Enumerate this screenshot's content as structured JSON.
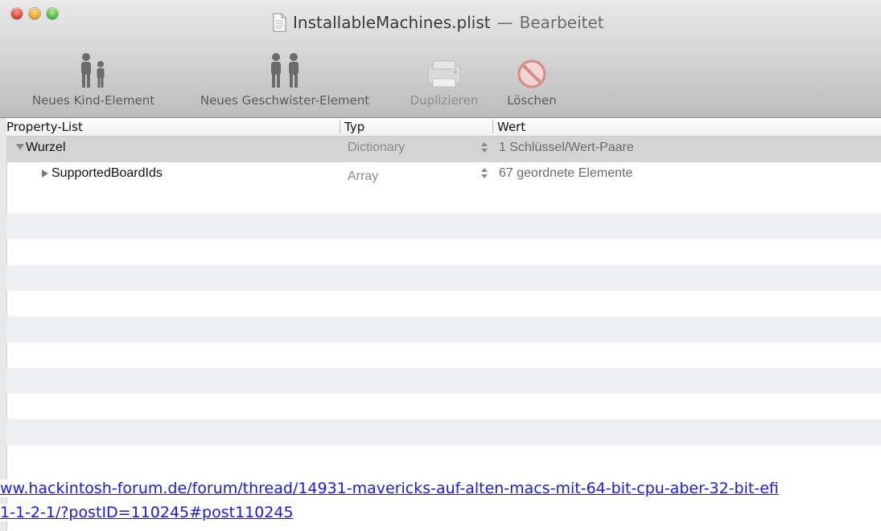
{
  "window": {
    "filename": "InstallableMachines.plist",
    "separator": "—",
    "state": "Bearbeitet"
  },
  "toolbar": {
    "new_child_label": "Neues Kind-Element",
    "new_sibling_label": "Neues Geschwister-Element",
    "duplicate_label": "Duplizieren",
    "delete_label": "Löschen"
  },
  "table": {
    "headers": {
      "key": "Property-List",
      "type": "Typ",
      "value": "Wert"
    },
    "rows": [
      {
        "key": "Wurzel",
        "type": "Dictionary",
        "value": "1 Schlüssel/Wert-Paare"
      },
      {
        "key": "SupportedBoardIds",
        "type": "Array",
        "value": "67 geordnete Elemente"
      }
    ]
  },
  "overlay": {
    "url_line1": "ww.hackintosh-forum.de/forum/thread/14931-mavericks-auf-alten-macs-mit-64-bit-cpu-aber-32-bit-efi",
    "url_line2": "1-1-2-1/?postID=110245#post110245"
  }
}
